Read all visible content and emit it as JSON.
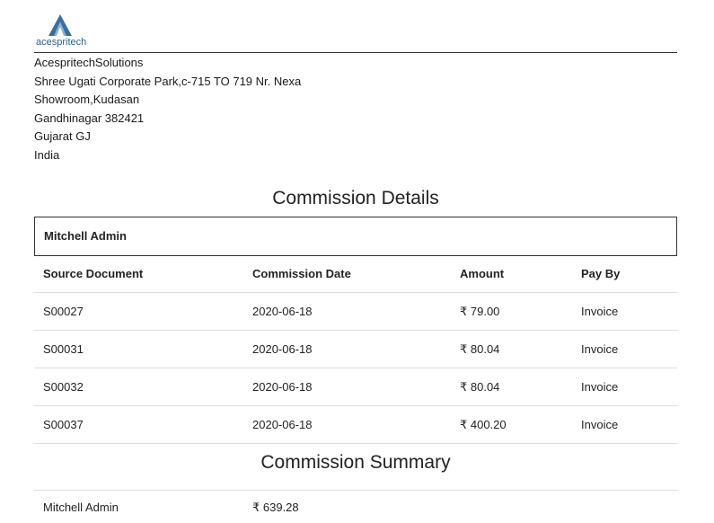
{
  "company": {
    "logo_icon": "triangle-logo-icon",
    "logo_text": "acespritech",
    "brand_color": "#2d5f8a",
    "address_lines": [
      "AcespritechSolutions",
      "Shree Ugati Corporate Park,c-715 TO 719 Nr. Nexa",
      "Showroom,Kudasan",
      "Gandhinagar 382421",
      "Gujarat GJ",
      "India"
    ]
  },
  "report": {
    "title": "Commission Details",
    "salesperson": "Mitchell Admin",
    "columns": [
      "Source Document",
      "Commission Date",
      "Amount",
      "Pay By"
    ],
    "rows": [
      [
        "S00027",
        "2020-06-18",
        "₹ 79.00",
        "Invoice"
      ],
      [
        "S00031",
        "2020-06-18",
        "₹ 80.04",
        "Invoice"
      ],
      [
        "S00032",
        "2020-06-18",
        "₹ 80.04",
        "Invoice"
      ],
      [
        "S00037",
        "2020-06-18",
        "₹ 400.20",
        "Invoice"
      ]
    ]
  },
  "summary": {
    "title": "Commission Summary",
    "name": "Mitchell Admin",
    "total": "₹ 639.28"
  }
}
